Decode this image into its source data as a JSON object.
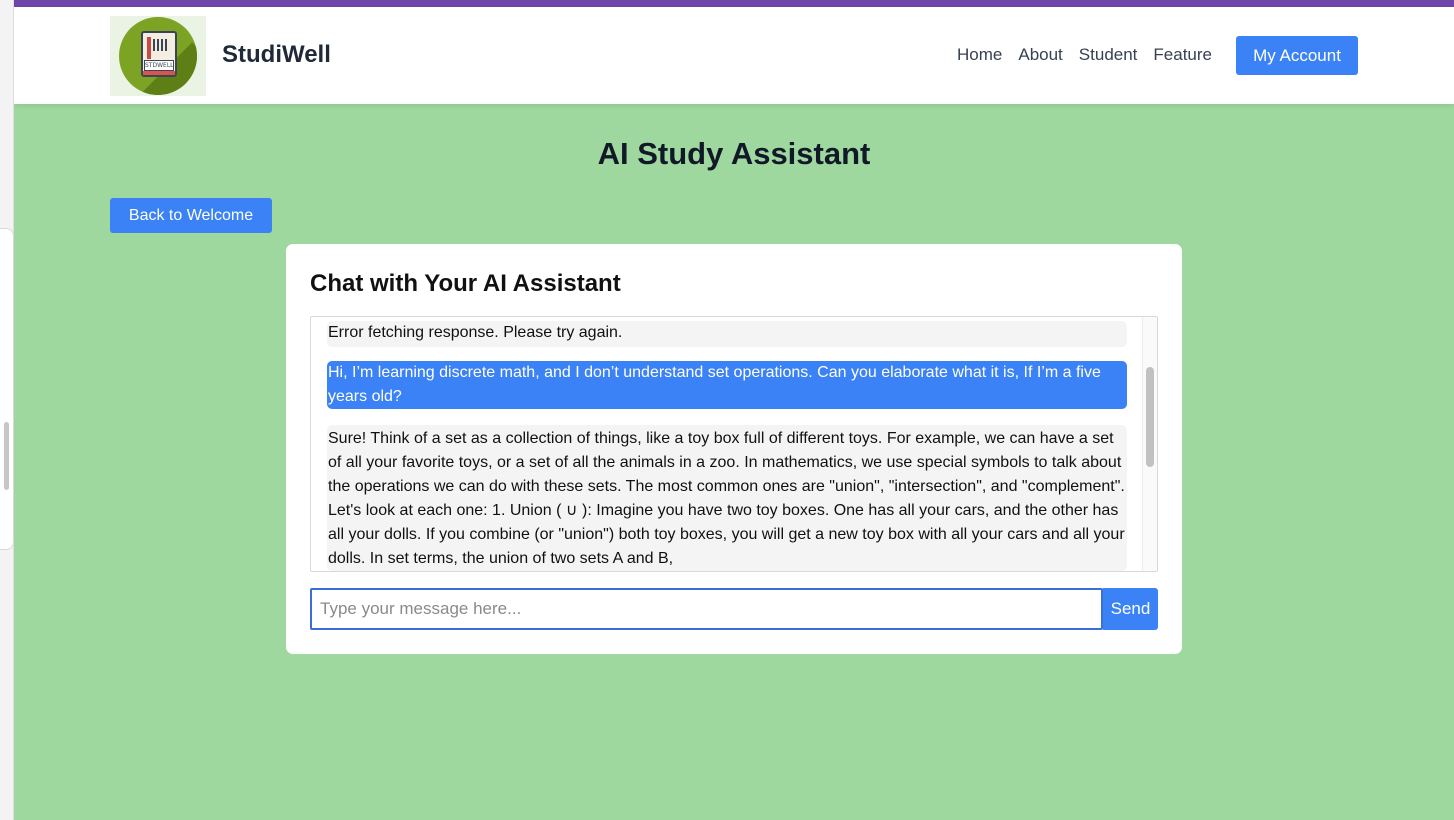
{
  "header": {
    "brand": "StudiWell",
    "logo_text": "STDWELL",
    "nav": [
      "Home",
      "About",
      "Student",
      "Feature"
    ],
    "account_label": "My Account"
  },
  "main": {
    "title": "AI Study Assistant",
    "back_label": "Back to Welcome"
  },
  "chat": {
    "title": "Chat with Your AI Assistant",
    "messages": [
      {
        "role": "assistant",
        "text": "Error fetching response. Please try again."
      },
      {
        "role": "user",
        "text": "Hi, I’m learning discrete math, and I don’t understand set operations. Can you elaborate what it is, If I’m a five years old?"
      },
      {
        "role": "assistant",
        "text": "Sure! Think of a set as a collection of things, like a toy box full of different toys. For example, we can have a set of all your favorite toys, or a set of all the animals in a zoo. In mathematics, we use special symbols to talk about the operations we can do with these sets. The most common ones are \"union\", \"intersection\", and \"complement\". Let's look at each one: 1. Union ( ∪ ): Imagine you have two toy boxes. One has all your cars, and the other has all your dolls. If you combine (or \"union\") both toy boxes, you will get a new toy box with all your cars and all your dolls. In set terms, the union of two sets A and B,"
      }
    ],
    "input_placeholder": "Type your message here...",
    "input_value": "",
    "send_label": "Send"
  },
  "colors": {
    "accent": "#3b82f6",
    "background": "#9ed89e",
    "topbar": "#6e45a8"
  }
}
